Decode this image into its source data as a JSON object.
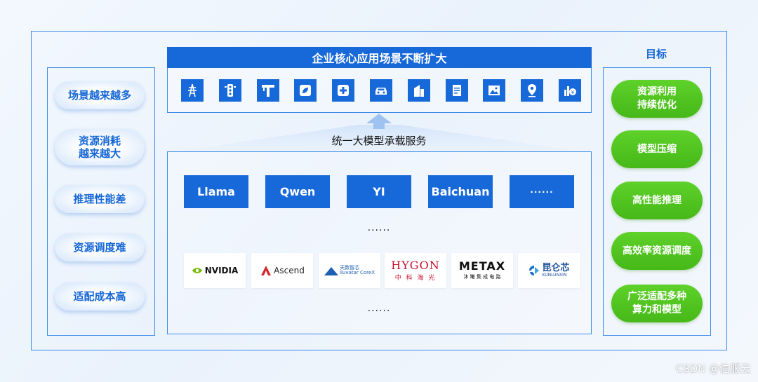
{
  "left_panel": {
    "items": [
      "场景越来越多",
      "资源消耗\n越来越大",
      "推理性能差",
      "资源调度难",
      "适配成本高"
    ]
  },
  "top": {
    "title": "企业核心应用场景不断扩大",
    "icons": [
      "power-tower-icon",
      "traffic-light-icon",
      "factory-crane-icon",
      "eco-leaf-icon",
      "medical-cross-icon",
      "car-icon",
      "building-icon",
      "document-icon",
      "image-icon",
      "map-pin-icon",
      "finance-icon"
    ]
  },
  "unified_label": "统一大模型承载服务",
  "models": [
    "Llama",
    "Qwen",
    "YI",
    "Baichuan",
    "······"
  ],
  "ellipsis": "······",
  "hardware": {
    "nvidia": "NVIDIA",
    "ascend": "Ascend",
    "iluvatar_cn": "天数智芯",
    "iluvatar_en": "Iluvatar CoreX",
    "hygon_en": "HYGON",
    "hygon_cn": "中 科 海 光",
    "metax_en": "METAX",
    "metax_cn": "沐 曦 集 成 电 路",
    "kunlun_cn": "昆仑芯",
    "kunlun_en": "KUNLUNXIN"
  },
  "goals": {
    "title": "目标",
    "items": [
      "资源利用\n持续优化",
      "模型压缩",
      "高性能推理",
      "高效率资源调度",
      "广泛适配多种\n算力和模型"
    ]
  },
  "watermark": "CSDN @信服云",
  "colors": {
    "primary_blue": "#1768d8",
    "goal_green": "#4cc21f",
    "frame_blue": "#3d8ce8"
  }
}
